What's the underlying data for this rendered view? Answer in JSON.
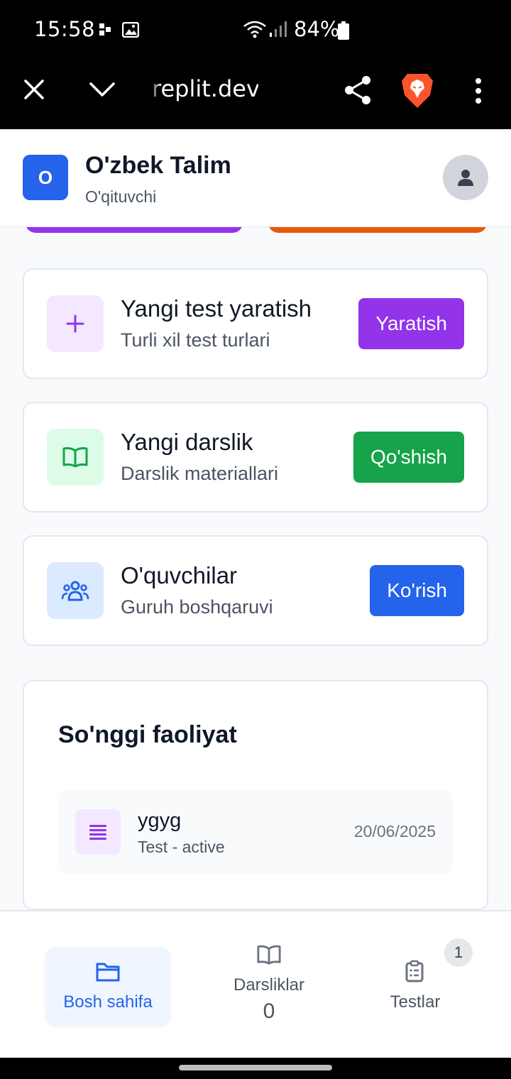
{
  "status_bar": {
    "time": "15:58",
    "battery": "84%"
  },
  "browser": {
    "url": "replit.dev"
  },
  "header": {
    "logo_letter": "O",
    "title": "O'zbek Talim",
    "subtitle": "O'qituvchi"
  },
  "actions": [
    {
      "title": "Yangi test yaratish",
      "subtitle": "Turli xil test turlari",
      "button": "Yaratish",
      "icon": "plus-icon",
      "color": "#9333ea"
    },
    {
      "title": "Yangi darslik",
      "subtitle": "Darslik materiallari",
      "button": "Qo'shish",
      "icon": "book-icon",
      "color": "#16a34a"
    },
    {
      "title": "O'quvchilar",
      "subtitle": "Guruh boshqaruvi",
      "button": "Ko'rish",
      "icon": "users-icon",
      "color": "#2563eb"
    }
  ],
  "activity": {
    "title": "So'nggi faoliyat",
    "items": [
      {
        "name": "ygyg",
        "meta": "Test - active",
        "date": "20/06/2025",
        "icon": "list-icon"
      }
    ]
  },
  "bottom_nav": {
    "home_label": "Bosh sahifa",
    "lessons_label": "Darsliklar",
    "lessons_count": "0",
    "tests_label": "Testlar",
    "tests_badge": "1"
  }
}
